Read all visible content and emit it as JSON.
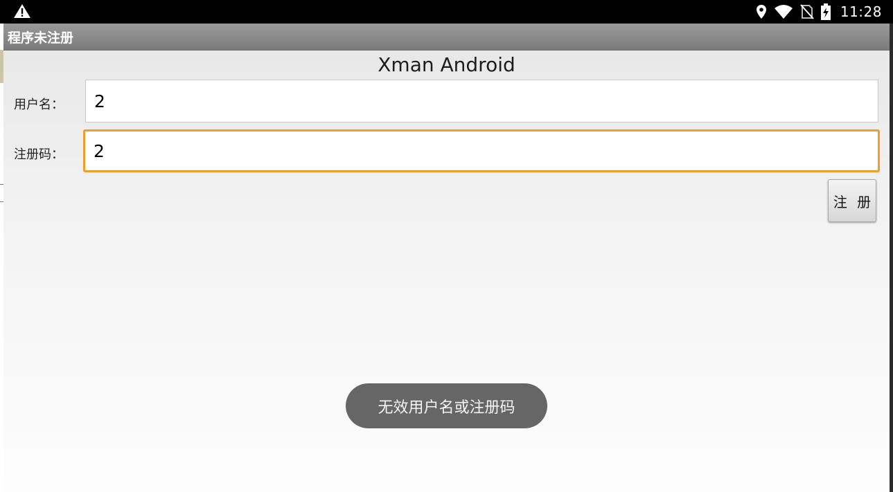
{
  "status_bar": {
    "time": "11:28",
    "icons": [
      "warning-icon",
      "location-icon",
      "wifi-icon",
      "no-sim-icon",
      "battery-charging-icon"
    ]
  },
  "title_bar": {
    "title": "程序未注册"
  },
  "main": {
    "heading": "Xman Android",
    "username": {
      "label": "用户名：",
      "value": "2"
    },
    "regcode": {
      "label": "注册码：",
      "value": "2",
      "focused": true,
      "focus_color": "#f39c2b"
    },
    "register_button": "注 册"
  },
  "toast": {
    "message": "无效用户名或注册码"
  }
}
